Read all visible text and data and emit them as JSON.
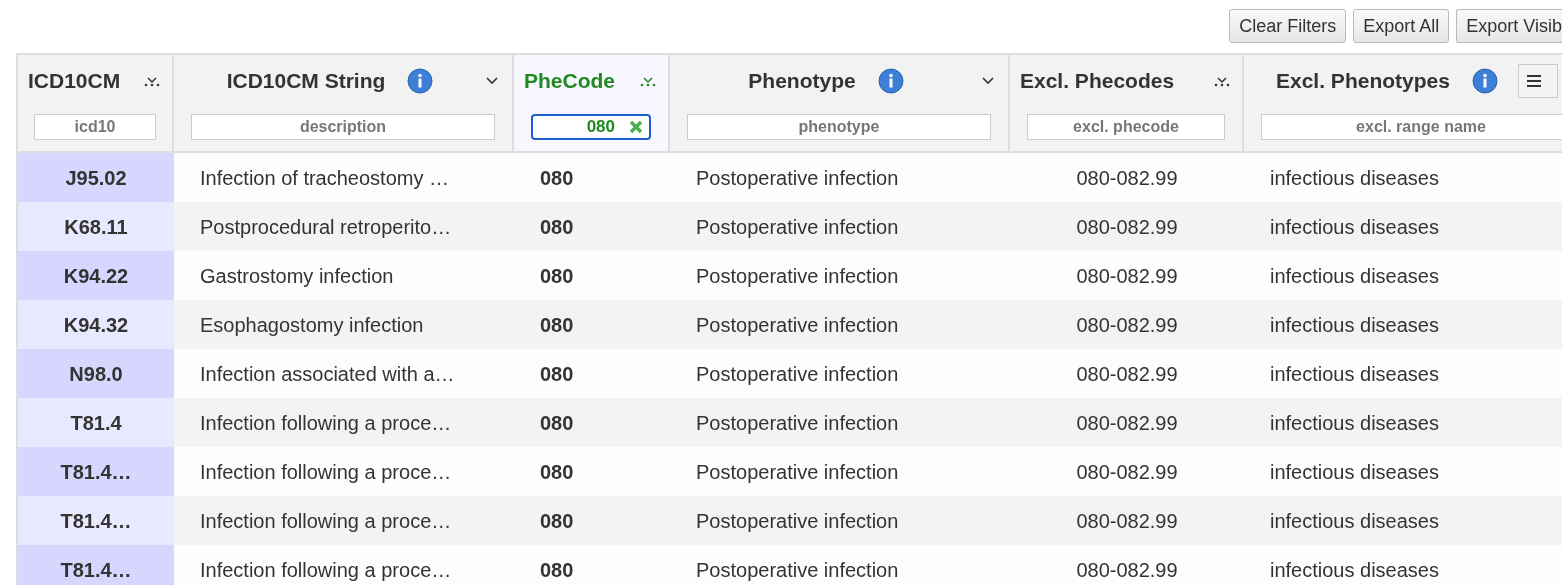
{
  "toolbar": {
    "buttons": [
      "Clear Filters",
      "Export All",
      "Export Visib"
    ]
  },
  "table": {
    "columns": [
      {
        "label": "ICD10CM",
        "kind": "sort",
        "filtered": false,
        "filter": {
          "placeholder": "icd10"
        }
      },
      {
        "label": "ICD10CM String",
        "kind": "info",
        "filtered": false,
        "filter": {
          "placeholder": "description"
        }
      },
      {
        "label": "PheCode",
        "kind": "sort",
        "filtered": true,
        "filter": {
          "value": "080"
        }
      },
      {
        "label": "Phenotype",
        "kind": "info",
        "filtered": false,
        "filter": {
          "placeholder": "phenotype"
        }
      },
      {
        "label": "Excl. Phecodes",
        "kind": "sort",
        "filtered": false,
        "filter": {
          "placeholder": "excl. phecode"
        }
      },
      {
        "label": "Excl. Phenotypes",
        "kind": "menu",
        "filtered": false,
        "filter": {
          "placeholder": "excl. range name"
        }
      }
    ],
    "rows": [
      [
        "J95.02",
        "Infection of tracheostomy …",
        "080",
        "Postoperative infection",
        "080-082.99",
        "infectious diseases"
      ],
      [
        "K68.11",
        "Postprocedural retroperito…",
        "080",
        "Postoperative infection",
        "080-082.99",
        "infectious diseases"
      ],
      [
        "K94.22",
        "Gastrostomy infection",
        "080",
        "Postoperative infection",
        "080-082.99",
        "infectious diseases"
      ],
      [
        "K94.32",
        "Esophagostomy infection",
        "080",
        "Postoperative infection",
        "080-082.99",
        "infectious diseases"
      ],
      [
        "N98.0",
        "Infection associated with a…",
        "080",
        "Postoperative infection",
        "080-082.99",
        "infectious diseases"
      ],
      [
        "T81.4",
        "Infection following a proce…",
        "080",
        "Postoperative infection",
        "080-082.99",
        "infectious diseases"
      ],
      [
        "T81.4…",
        "Infection following a proce…",
        "080",
        "Postoperative infection",
        "080-082.99",
        "infectious diseases"
      ],
      [
        "T81.4…",
        "Infection following a proce…",
        "080",
        "Postoperative infection",
        "080-082.99",
        "infectious diseases"
      ],
      [
        "T81.4…",
        "Infection following a proce…",
        "080",
        "Postoperative infection",
        "080-082.99",
        "infectious diseases"
      ]
    ]
  }
}
